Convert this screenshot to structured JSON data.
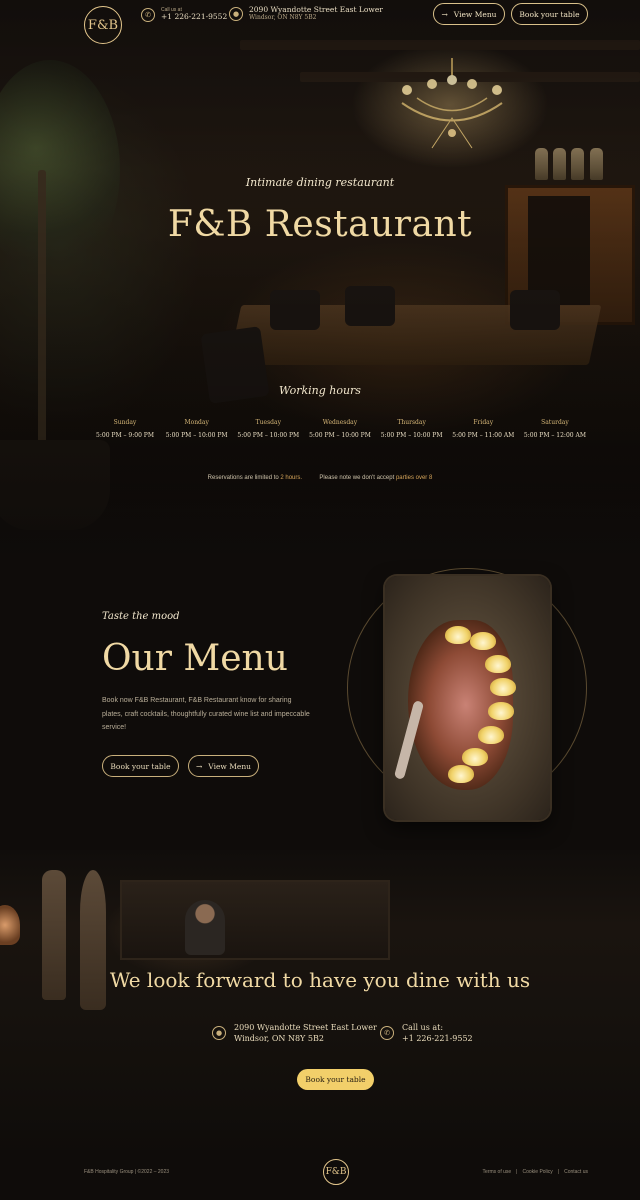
{
  "header": {
    "logo": "F&B",
    "call_label": "Call us at",
    "phone": "+1 226-221-9552",
    "address_line1": "2090 Wyandotte Street East Lower",
    "address_line2": "Windsor, ON N8Y 5B2",
    "view_menu_label": "View Menu",
    "book_table_label": "Book your table"
  },
  "hero": {
    "tagline": "Intimate dining restaurant",
    "title": "F&B Restaurant",
    "working_hours_title": "Working hours",
    "days": [
      {
        "name": "Sunday",
        "hours": "5:00 PM – 9:00 PM"
      },
      {
        "name": "Monday",
        "hours": "5:00 PM – 10:00 PM"
      },
      {
        "name": "Tuesday",
        "hours": "5:00 PM – 10:00 PM"
      },
      {
        "name": "Wednesday",
        "hours": "5:00 PM – 10:00 PM"
      },
      {
        "name": "Thursday",
        "hours": "5:00 PM – 10:00 PM"
      },
      {
        "name": "Friday",
        "hours": "5:00 PM – 11:00 AM"
      },
      {
        "name": "Saturday",
        "hours": "5:00 PM – 12:00 AM"
      }
    ],
    "note_part1": "Reservations are limited to",
    "note_hl1": "2 hours.",
    "note_part2": "Please note we don't accept",
    "note_hl2": "parties over 8"
  },
  "menu": {
    "tagline": "Taste the mood",
    "title": "Our Menu",
    "description": "Book now F&B Restaurant, F&B Restaurant know for sharing plates, craft cocktails, thoughtfully curated wine list and impeccable service!",
    "book_label": "Book your table",
    "view_label": "View Menu"
  },
  "cta": {
    "title": "We look forward to have you dine with us",
    "address_line1": "2090 Wyandotte Street East Lower",
    "address_line2": "Windsor, ON N8Y 5B2",
    "call_label": "Call us at:",
    "phone": "+1 226-221-9552",
    "book_label": "Book your table"
  },
  "footer": {
    "copyright": "F&B Hospitality Group | ©2022 – 2023",
    "logo": "F&B",
    "links": [
      "Terms of use",
      "|",
      "Cookie Policy",
      "|",
      "Contact us"
    ]
  },
  "colors": {
    "accent_gold": "#e3c68c",
    "button_yellow": "#f2cf6a",
    "background": "#0f0c0a"
  }
}
